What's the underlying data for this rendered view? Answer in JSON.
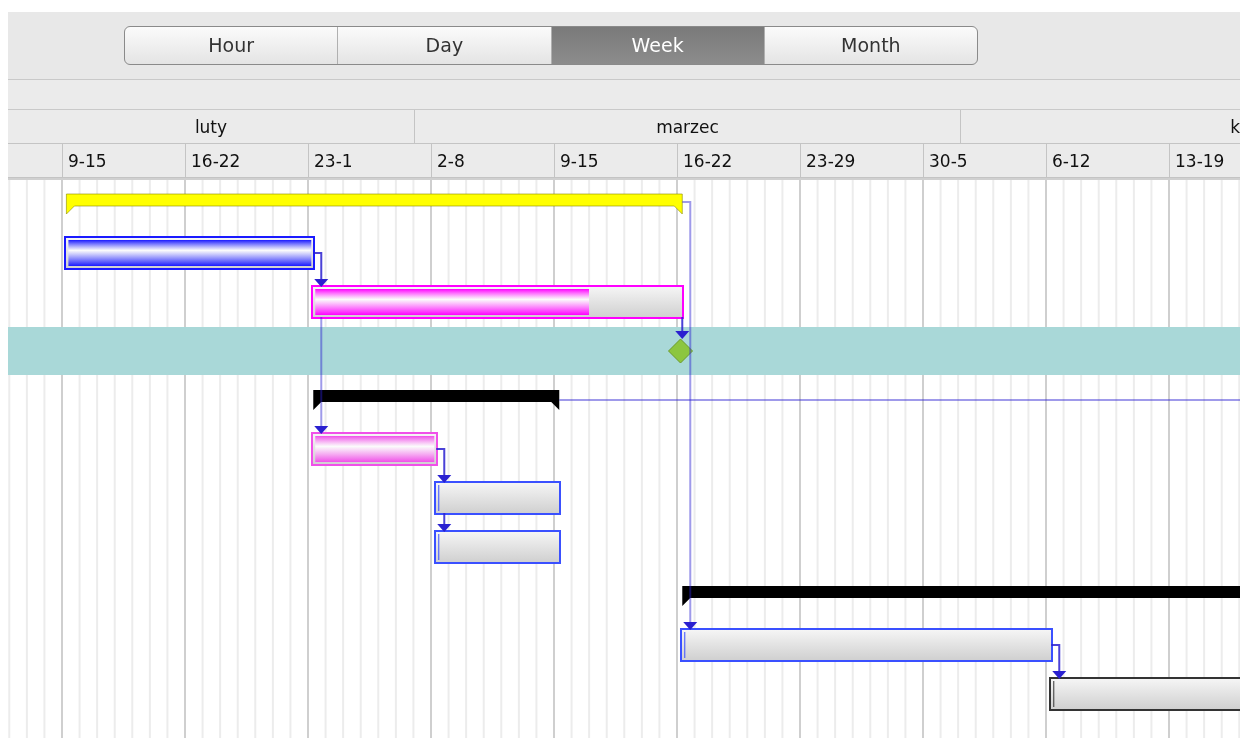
{
  "view_switcher": [
    {
      "label": "Hour",
      "selected": false
    },
    {
      "label": "Day",
      "selected": false
    },
    {
      "label": "Week",
      "selected": true
    },
    {
      "label": "Month",
      "selected": false
    }
  ],
  "timeline": {
    "months": [
      "luty",
      "marzec",
      "k"
    ],
    "weeks": [
      "9-15",
      "16-22",
      "23-1",
      "2-8",
      "9-15",
      "16-22",
      "23-29",
      "30-5",
      "6-12",
      "13-19"
    ]
  },
  "tasks": [
    {
      "kind": "summary",
      "color": "#ffff00",
      "selected": false
    },
    {
      "kind": "task",
      "color": "#1a1aff",
      "level": 1,
      "selected": false
    },
    {
      "kind": "task",
      "color": "#ff00ff",
      "level": 0.75,
      "selected": false
    },
    {
      "kind": "milestone",
      "color": "#8cc63f",
      "selected": true
    },
    {
      "kind": "summary",
      "color": "#000000",
      "selected": false
    },
    {
      "kind": "task",
      "color": "#f050e8",
      "level": 1,
      "selected": false
    },
    {
      "kind": "task",
      "color": "#3a50ff",
      "level": 0,
      "selected": false
    },
    {
      "kind": "task",
      "color": "#3a50ff",
      "level": 0,
      "selected": false
    },
    {
      "kind": "summary",
      "color": "#000000",
      "selected": false
    },
    {
      "kind": "task",
      "color": "#3a50ff",
      "level": 0,
      "selected": false
    },
    {
      "kind": "task",
      "color": "#333333",
      "level": 0,
      "selected": false
    }
  ]
}
